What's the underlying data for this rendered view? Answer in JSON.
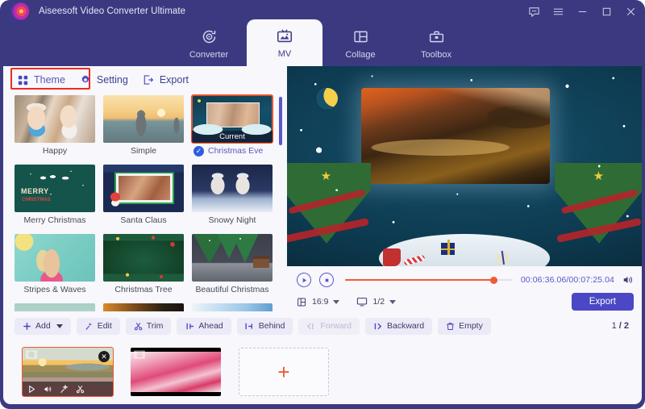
{
  "window": {
    "app_title": "Aiseesoft Video Converter Ultimate",
    "controls": [
      {
        "name": "feedback-icon",
        "label": "Feedback"
      },
      {
        "name": "menu-icon",
        "label": "Menu"
      },
      {
        "name": "minimize-icon",
        "label": "Minimize"
      },
      {
        "name": "maximize-icon",
        "label": "Maximize"
      },
      {
        "name": "close-icon",
        "label": "Close"
      }
    ],
    "accent_purple": "#3b3a80",
    "accent_indigo": "#4a48c4",
    "accent_orange": "#ef5b33",
    "highlight_red": "#ee2b20"
  },
  "main_tabs": [
    {
      "label": "Converter",
      "icon": "converter-icon",
      "active": false
    },
    {
      "label": "MV",
      "icon": "mv-icon",
      "active": true
    },
    {
      "label": "Collage",
      "icon": "collage-icon",
      "active": false
    },
    {
      "label": "Toolbox",
      "icon": "toolbox-icon",
      "active": false
    }
  ],
  "sub_tabs": [
    {
      "label": "Theme",
      "icon": "theme-grid-icon",
      "active": true,
      "highlighted": true
    },
    {
      "label": "Setting",
      "icon": "gear-icon",
      "active": false,
      "highlighted": false
    },
    {
      "label": "Export",
      "icon": "export-icon",
      "active": false,
      "highlighted": false
    }
  ],
  "themes": [
    {
      "label": "Happy",
      "art": "art-happy",
      "selected": false,
      "badge": ""
    },
    {
      "label": "Simple",
      "art": "art-simple",
      "selected": false,
      "badge": ""
    },
    {
      "label": "Christmas Eve",
      "art": "art-xmaseve",
      "selected": true,
      "badge": "Current"
    },
    {
      "label": "Merry Christmas",
      "art": "art-merry",
      "selected": false,
      "badge": ""
    },
    {
      "label": "Santa Claus",
      "art": "art-santa",
      "selected": false,
      "badge": ""
    },
    {
      "label": "Snowy Night",
      "art": "art-snowy",
      "selected": false,
      "badge": ""
    },
    {
      "label": "Stripes & Waves",
      "art": "art-stripes",
      "selected": false,
      "badge": ""
    },
    {
      "label": "Christmas Tree",
      "art": "art-tree",
      "selected": false,
      "badge": ""
    },
    {
      "label": "Beautiful Christmas",
      "art": "art-beautiful",
      "selected": false,
      "badge": ""
    }
  ],
  "theme_overlay_text": {
    "merry_line1": "MERRY",
    "merry_line2": "CHRISTMAS"
  },
  "player": {
    "play_icon": "play-circle-icon",
    "stop_icon": "stop-circle-icon",
    "progress_percent": 88.5,
    "current_time": "00:06:36.06",
    "total_time": "00:07:25.04",
    "time_display": "00:06:36.06/00:07:25.04",
    "volume_icon": "volume-icon",
    "aspect_ratio": {
      "icon": "aspect-ratio-icon",
      "value": "16:9"
    },
    "screen_split": {
      "icon": "monitor-icon",
      "value": "1/2"
    },
    "export_label": "Export"
  },
  "action_buttons": [
    {
      "label": "Add",
      "icon": "plus-icon",
      "dropdown": true,
      "disabled": false
    },
    {
      "label": "Edit",
      "icon": "magic-wand-icon",
      "dropdown": false,
      "disabled": false
    },
    {
      "label": "Trim",
      "icon": "scissors-icon",
      "dropdown": false,
      "disabled": false
    },
    {
      "label": "Ahead",
      "icon": "insert-ahead-icon",
      "dropdown": false,
      "disabled": false
    },
    {
      "label": "Behind",
      "icon": "insert-behind-icon",
      "dropdown": false,
      "disabled": false
    },
    {
      "label": "Forward",
      "icon": "move-forward-icon",
      "dropdown": false,
      "disabled": true
    },
    {
      "label": "Backward",
      "icon": "move-backward-icon",
      "dropdown": false,
      "disabled": false
    },
    {
      "label": "Empty",
      "icon": "trash-icon",
      "dropdown": false,
      "disabled": false
    }
  ],
  "page_indicator": {
    "current": "1",
    "separator": "/",
    "total": "2",
    "text": "1 / 2"
  },
  "clips": [
    {
      "name": "clip-1",
      "art": "clip-art1",
      "selected": true,
      "has_close": true,
      "tools": [
        "play-icon",
        "volume-icon",
        "magic-wand-icon",
        "scissors-icon"
      ]
    },
    {
      "name": "clip-2",
      "art": "clip-art2",
      "selected": false,
      "has_close": false,
      "tools": []
    }
  ],
  "add_clip": {
    "label": "+",
    "name": "add-clip-button"
  }
}
